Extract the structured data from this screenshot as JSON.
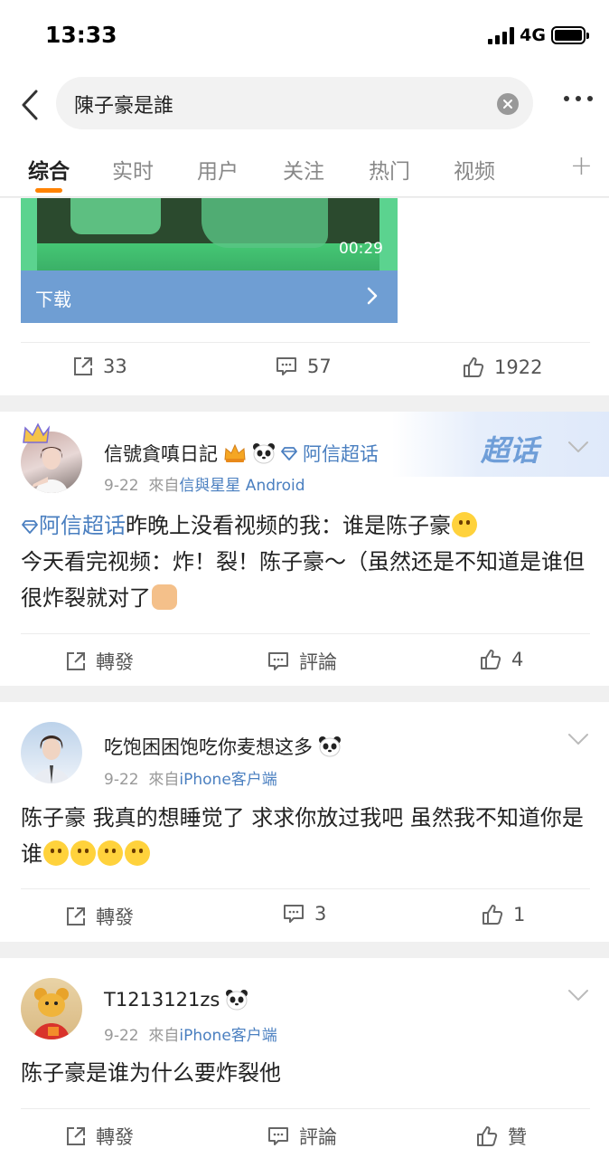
{
  "status_bar": {
    "time": "13:33",
    "network": "4G"
  },
  "search": {
    "query": "陳子豪是誰"
  },
  "tabs": [
    {
      "label": "综合",
      "active": true
    },
    {
      "label": "实时"
    },
    {
      "label": "用户"
    },
    {
      "label": "关注"
    },
    {
      "label": "热门"
    },
    {
      "label": "视频"
    }
  ],
  "tab_add": "+",
  "first_post": {
    "video_duration": "00:29",
    "download_label": "下载",
    "repost_count": "33",
    "comment_count": "57",
    "like_count": "1922"
  },
  "posts": [
    {
      "username": "信號貪嗔日記",
      "topic_badge": "阿信超话",
      "banner_text": "超话",
      "date": "9-22",
      "source_prefix": "來自",
      "source": "信與星星 Android",
      "topic_link": "阿信超话",
      "text_part1": "昨晚上没看视频的我：谁是陈子豪",
      "text_part2": "今天看完视频：炸！裂！陈子豪～（虽然还是不知道是谁但很炸裂就对了",
      "repost_label": "轉發",
      "comment_label": "評論",
      "like_count": "4"
    },
    {
      "username": "吃饱困困饱吃你麦想这多",
      "date": "9-22",
      "source_prefix": "來自",
      "source": "iPhone客户端",
      "text": "陈子豪 我真的想睡觉了 求求你放过我吧 虽然我不知道你是谁",
      "repost_label": "轉發",
      "comment_count": "3",
      "like_count": "1"
    },
    {
      "username": "T1213121zs",
      "date": "9-22",
      "source_prefix": "來自",
      "source": "iPhone客户端",
      "text": "陈子豪是谁为什么要炸裂他",
      "repost_label": "轉發",
      "comment_label": "評論",
      "like_label": "贊"
    }
  ],
  "colors": {
    "accent": "#ff8200",
    "link": "#4a7fc0",
    "download_bar": "#6f9ed3"
  }
}
